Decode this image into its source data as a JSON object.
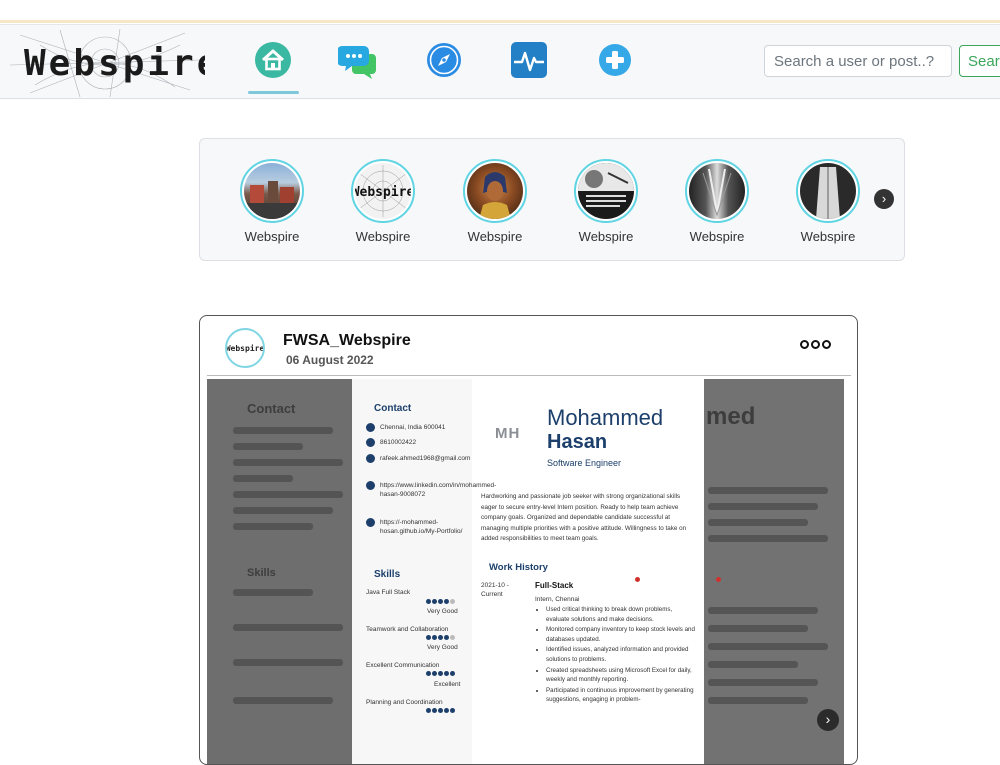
{
  "app": {
    "logo_text": "Webspire",
    "brand_color": "#1b1b1b",
    "accent_color": "#5fd4e3"
  },
  "nav": {
    "icons": [
      "home-icon",
      "chat-icon",
      "compass-icon",
      "activity-icon",
      "plus-icon"
    ],
    "active": "home-icon"
  },
  "search": {
    "placeholder": "Search a user or post..?",
    "value": "",
    "button_label": "Search"
  },
  "stories": {
    "items": [
      {
        "name": "Webspire",
        "image": "street-photo"
      },
      {
        "name": "Webspire",
        "image": "webspire-logo"
      },
      {
        "name": "Webspire",
        "image": "egyptian-portrait"
      },
      {
        "name": "Webspire",
        "image": "quote-poster"
      },
      {
        "name": "Webspire",
        "image": "corridor-photo"
      },
      {
        "name": "Webspire",
        "image": "robe-photo"
      }
    ],
    "next_icon": "chevron-right-icon"
  },
  "post": {
    "avatar_text": "Webspire",
    "username": "FWSA_Webspire",
    "date": "06 August 2022",
    "more_icon": "more-icon",
    "resume": {
      "initials": "MH",
      "first_name": "Mohammed",
      "last_name": "Hasan",
      "role": "Software Engineer",
      "contact_heading": "Contact",
      "contact": [
        "Chennai, India 600041",
        "8610002422",
        "rafeek.ahmed1968@gmail.com",
        "https://www.linkedin.com/in/mohammed-hasan-9008072",
        "https://-mohammed-hosan.github.io/My-Portfolio/"
      ],
      "skills_heading": "Skills",
      "skills": [
        {
          "name": "Java Full Stack",
          "level": "Very Good"
        },
        {
          "name": "Teamwork and Collaboration",
          "level": "Very Good"
        },
        {
          "name": "Excellent Communication",
          "level": "Excellent"
        },
        {
          "name": "Planning and Coordination",
          "level": ""
        }
      ],
      "summary": "Hardworking and passionate job seeker with strong organizational skills eager to secure entry-level Intern position. Ready to help team achieve company goals. Organized and dependable candidate successful at managing multiple priorities with a positive attitude. Willingness to take on added responsibilities to meet team goals.",
      "work_heading": "Work History",
      "work_date": "2021-10 - Current",
      "work_title": "Full-Stack",
      "work_company": "Intern, Chennai",
      "work_bullets": [
        "Used critical thinking to break down problems, evaluate solutions and make decisions.",
        "Monitored company inventory to keep stock levels and databases updated.",
        "Identified issues, analyzed information and provided solutions to problems.",
        "Created spreadsheets using Microsoft Excel for daily, weekly and monthly reporting.",
        "Participated in continuous improvement by generating suggestions, engaging in problem-"
      ]
    }
  }
}
